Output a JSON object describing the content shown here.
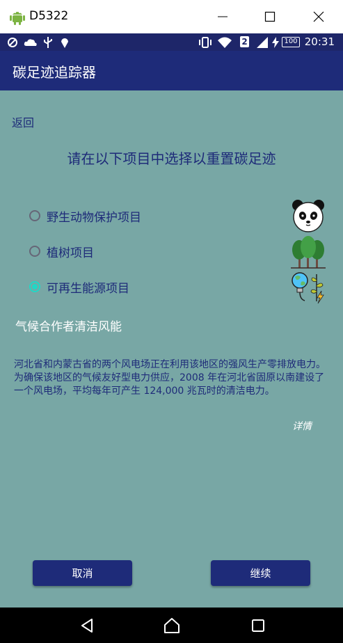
{
  "window": {
    "title": "D5322"
  },
  "status": {
    "time": "20:31",
    "sim_badge": "2",
    "battery": "100"
  },
  "app": {
    "title": "碳足迹追踪器"
  },
  "main": {
    "back_label": "返回",
    "prompt": "请在以下项目中选择以重置碳足迹",
    "options": [
      {
        "label": "野生动物保护项目",
        "selected": false,
        "icon": "panda-icon"
      },
      {
        "label": "植树项目",
        "selected": false,
        "icon": "trees-icon"
      },
      {
        "label": "可再生能源项目",
        "selected": true,
        "icon": "renewable-energy-icon"
      }
    ],
    "detail_title": "气候合作者清洁风能",
    "detail_text": "河北省和内蒙古省的两个风电场正在利用该地区的强风生产零排放电力。 为确保该地区的气候友好型电力供应，2008 年在河北省固原以南建设了一个风电场，平均每年可产生 124,000 兆瓦时的清洁电力。",
    "more_label": "详情",
    "cancel_label": "取消",
    "continue_label": "继续"
  },
  "colors": {
    "primary": "#1e2b79",
    "status_bar": "#1e2669",
    "background": "#78a7a5",
    "accent": "#21d8c6"
  }
}
